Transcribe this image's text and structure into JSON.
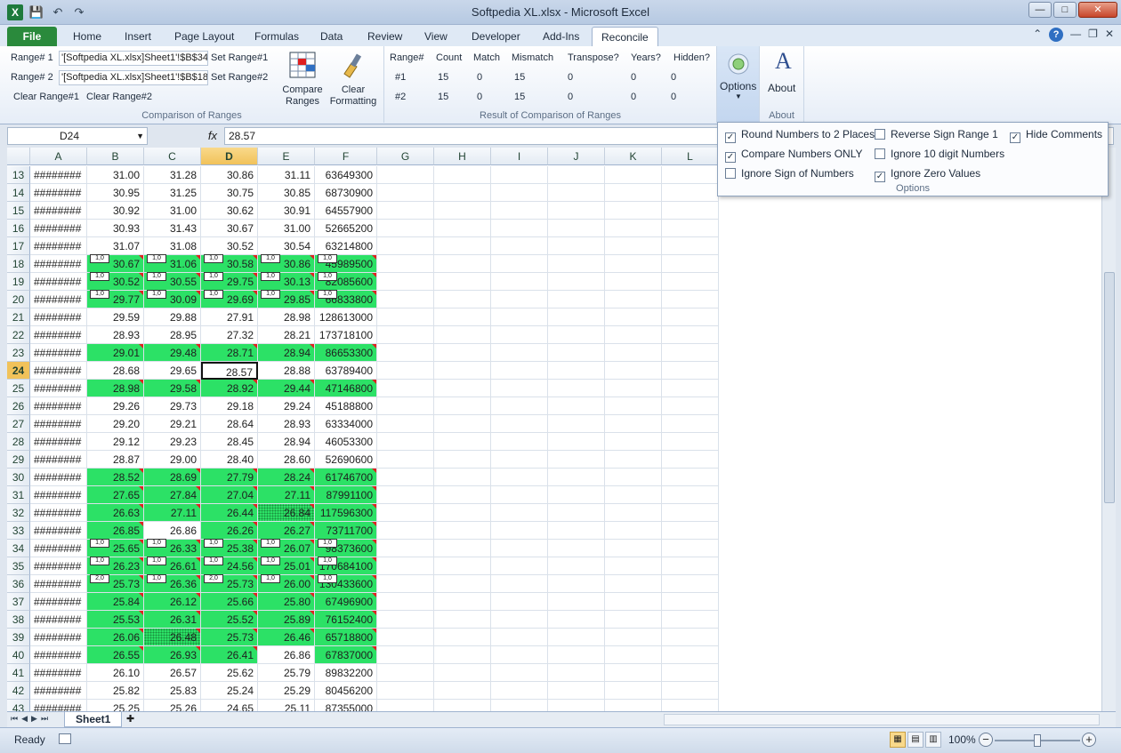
{
  "window": {
    "title": "Softpedia XL.xlsx  -  Microsoft Excel"
  },
  "qat": {
    "save": "💾",
    "undo": "↶",
    "redo": "↷"
  },
  "tabs": [
    "File",
    "Home",
    "Insert",
    "Page Layout",
    "Formulas",
    "Data",
    "Review",
    "View",
    "Developer",
    "Add-Ins",
    "Reconcile"
  ],
  "ribbon": {
    "range1_label": "Range# 1",
    "range1_value": "'[Softpedia XL.xlsx]Sheet1'!$B$34",
    "range2_label": "Range# 2",
    "range2_value": "'[Softpedia XL.xlsx]Sheet1'!$B$18",
    "set_range1": "Set Range#1",
    "set_range2": "Set Range#2",
    "clear_range1": "Clear Range#1",
    "clear_range2": "Clear Range#2",
    "compare_label": "Compare Ranges",
    "clear_fmt_label": "Clear Formatting",
    "group_comparison": "Comparison of Ranges",
    "result_headers": [
      "Range#",
      "Count",
      "Match",
      "Mismatch",
      "Transpose?",
      "Years?",
      "Hidden?"
    ],
    "result_rows": [
      [
        "#1",
        "15",
        "0",
        "15",
        "0",
        "0",
        "0"
      ],
      [
        "#2",
        "15",
        "0",
        "15",
        "0",
        "0",
        "0"
      ]
    ],
    "group_result": "Result of Comparison of Ranges",
    "options_label": "Options",
    "about_label": "About",
    "group_about": "About"
  },
  "options_panel": {
    "items": [
      {
        "label": "Round Numbers to 2 Places",
        "checked": true
      },
      {
        "label": "Reverse Sign Range 1",
        "checked": false
      },
      {
        "label": "Hide Comments",
        "checked": true
      },
      {
        "label": "Compare Numbers ONLY",
        "checked": true
      },
      {
        "label": "Ignore 10 digit Numbers",
        "checked": false
      },
      {
        "label": "Ignore Sign of Numbers",
        "checked": false
      },
      {
        "label": "Ignore Zero Values",
        "checked": true
      }
    ],
    "group": "Options"
  },
  "formula": {
    "name_box": "D24",
    "fx": "fx",
    "value": "28.57"
  },
  "columns": [
    "A",
    "B",
    "C",
    "D",
    "E",
    "F",
    "G",
    "H",
    "I",
    "J",
    "K",
    "L"
  ],
  "rows": [
    {
      "n": "13",
      "a": "########",
      "b": "31.00",
      "c": "31.28",
      "d": "30.86",
      "e": "31.11",
      "f": "63649300",
      "g": []
    },
    {
      "n": "14",
      "a": "########",
      "b": "30.95",
      "c": "31.25",
      "d": "30.75",
      "e": "30.85",
      "f": "68730900",
      "g": []
    },
    {
      "n": "15",
      "a": "########",
      "b": "30.92",
      "c": "31.00",
      "d": "30.62",
      "e": "30.91",
      "f": "64557900",
      "g": []
    },
    {
      "n": "16",
      "a": "########",
      "b": "30.93",
      "c": "31.43",
      "d": "30.67",
      "e": "31.00",
      "f": "52665200",
      "g": []
    },
    {
      "n": "17",
      "a": "########",
      "b": "31.07",
      "c": "31.08",
      "d": "30.52",
      "e": "30.54",
      "f": "63214800",
      "g": []
    },
    {
      "n": "18",
      "a": "########",
      "b": "30.67",
      "c": "31.06",
      "d": "30.58",
      "e": "30.86",
      "f": "45989500",
      "g": [
        "b",
        "c",
        "d",
        "e",
        "f"
      ],
      "notes": [
        "1,0",
        "1,0",
        "1,0",
        "1,0",
        "1,0"
      ]
    },
    {
      "n": "19",
      "a": "########",
      "b": "30.52",
      "c": "30.55",
      "d": "29.75",
      "e": "30.13",
      "f": "82085600",
      "g": [
        "b",
        "c",
        "d",
        "e",
        "f"
      ],
      "notes": [
        "1,0",
        "1,0",
        "1,0",
        "1,0",
        "1,0"
      ]
    },
    {
      "n": "20",
      "a": "########",
      "b": "29.77",
      "c": "30.09",
      "d": "29.69",
      "e": "29.85",
      "f": "66833800",
      "g": [
        "b",
        "c",
        "d",
        "e",
        "f"
      ],
      "notes": [
        "1,0",
        "1,0",
        "1,0",
        "1,0",
        "1,0"
      ]
    },
    {
      "n": "21",
      "a": "########",
      "b": "29.59",
      "c": "29.88",
      "d": "27.91",
      "e": "28.98",
      "f": "128613000",
      "g": []
    },
    {
      "n": "22",
      "a": "########",
      "b": "28.93",
      "c": "28.95",
      "d": "27.32",
      "e": "28.21",
      "f": "173718100",
      "g": []
    },
    {
      "n": "23",
      "a": "########",
      "b": "29.01",
      "c": "29.48",
      "d": "28.71",
      "e": "28.94",
      "f": "86653300",
      "g": [
        "b",
        "c",
        "d",
        "e",
        "f"
      ]
    },
    {
      "n": "24",
      "a": "########",
      "b": "28.68",
      "c": "29.65",
      "d": "28.57",
      "e": "28.88",
      "f": "63789400",
      "g": []
    },
    {
      "n": "25",
      "a": "########",
      "b": "28.98",
      "c": "29.58",
      "d": "28.92",
      "e": "29.44",
      "f": "47146800",
      "g": [
        "b",
        "c",
        "d",
        "e",
        "f"
      ]
    },
    {
      "n": "26",
      "a": "########",
      "b": "29.26",
      "c": "29.73",
      "d": "29.18",
      "e": "29.24",
      "f": "45188800",
      "g": []
    },
    {
      "n": "27",
      "a": "########",
      "b": "29.20",
      "c": "29.21",
      "d": "28.64",
      "e": "28.93",
      "f": "63334000",
      "g": []
    },
    {
      "n": "28",
      "a": "########",
      "b": "29.12",
      "c": "29.23",
      "d": "28.45",
      "e": "28.94",
      "f": "46053300",
      "g": []
    },
    {
      "n": "29",
      "a": "########",
      "b": "28.87",
      "c": "29.00",
      "d": "28.40",
      "e": "28.60",
      "f": "52690600",
      "g": []
    },
    {
      "n": "30",
      "a": "########",
      "b": "28.52",
      "c": "28.69",
      "d": "27.79",
      "e": "28.24",
      "f": "61746700",
      "g": [
        "b",
        "c",
        "d",
        "e",
        "f"
      ]
    },
    {
      "n": "31",
      "a": "########",
      "b": "27.65",
      "c": "27.84",
      "d": "27.04",
      "e": "27.11",
      "f": "87991100",
      "g": [
        "b",
        "c",
        "d",
        "e",
        "f"
      ]
    },
    {
      "n": "32",
      "a": "########",
      "b": "26.63",
      "c": "27.11",
      "d": "26.44",
      "e": "26.84",
      "f": "117596300",
      "g": [
        "b",
        "c",
        "d",
        "e",
        "f"
      ],
      "hatch": [
        "e"
      ]
    },
    {
      "n": "33",
      "a": "########",
      "b": "26.85",
      "c": "26.86",
      "d": "26.26",
      "e": "26.27",
      "f": "73711700",
      "g": [
        "b",
        "d",
        "e",
        "f"
      ]
    },
    {
      "n": "34",
      "a": "########",
      "b": "25.65",
      "c": "26.33",
      "d": "25.38",
      "e": "26.07",
      "f": "98373600",
      "g": [
        "b",
        "c",
        "d",
        "e",
        "f"
      ],
      "notes": [
        "1,0",
        "1,0",
        "1,0",
        "1,0",
        "1,0"
      ]
    },
    {
      "n": "35",
      "a": "########",
      "b": "26.23",
      "c": "26.61",
      "d": "24.56",
      "e": "25.01",
      "f": "170684100",
      "g": [
        "b",
        "c",
        "d",
        "e",
        "f"
      ],
      "notes": [
        "1,0",
        "1,0",
        "1,0",
        "1,0",
        "1,0"
      ]
    },
    {
      "n": "36",
      "a": "########",
      "b": "25.73",
      "c": "26.36",
      "d": "25.73",
      "e": "26.00",
      "f": "130433600",
      "g": [
        "b",
        "c",
        "d",
        "e",
        "f"
      ],
      "notes": [
        "2,0",
        "1,0",
        "2,0",
        "1,0",
        "1,0"
      ]
    },
    {
      "n": "37",
      "a": "########",
      "b": "25.84",
      "c": "26.12",
      "d": "25.66",
      "e": "25.80",
      "f": "67496900",
      "g": [
        "b",
        "c",
        "d",
        "e",
        "f"
      ]
    },
    {
      "n": "38",
      "a": "########",
      "b": "25.53",
      "c": "26.31",
      "d": "25.52",
      "e": "25.89",
      "f": "76152400",
      "g": [
        "b",
        "c",
        "d",
        "e",
        "f"
      ]
    },
    {
      "n": "39",
      "a": "########",
      "b": "26.06",
      "c": "26.48",
      "d": "25.73",
      "e": "26.46",
      "f": "65718800",
      "g": [
        "b",
        "c",
        "d",
        "e",
        "f"
      ],
      "hatch": [
        "c"
      ]
    },
    {
      "n": "40",
      "a": "########",
      "b": "26.55",
      "c": "26.93",
      "d": "26.41",
      "e": "26.86",
      "f": "67837000",
      "g": [
        "b",
        "c",
        "d",
        "f"
      ]
    },
    {
      "n": "41",
      "a": "########",
      "b": "26.10",
      "c": "26.57",
      "d": "25.62",
      "e": "25.79",
      "f": "89832200",
      "g": []
    },
    {
      "n": "42",
      "a": "########",
      "b": "25.82",
      "c": "25.83",
      "d": "25.24",
      "e": "25.29",
      "f": "80456200",
      "g": []
    },
    {
      "n": "43",
      "a": "########",
      "b": "25.25",
      "c": "25.26",
      "d": "24.65",
      "e": "25.11",
      "f": "87355000",
      "g": []
    }
  ],
  "sheet": {
    "tab": "Sheet1"
  },
  "status": {
    "ready": "Ready",
    "zoom": "100%"
  },
  "colors": {
    "match_green": "#2ce166",
    "file_tab": "#2a8a3c",
    "selection": "#f1c25a"
  }
}
